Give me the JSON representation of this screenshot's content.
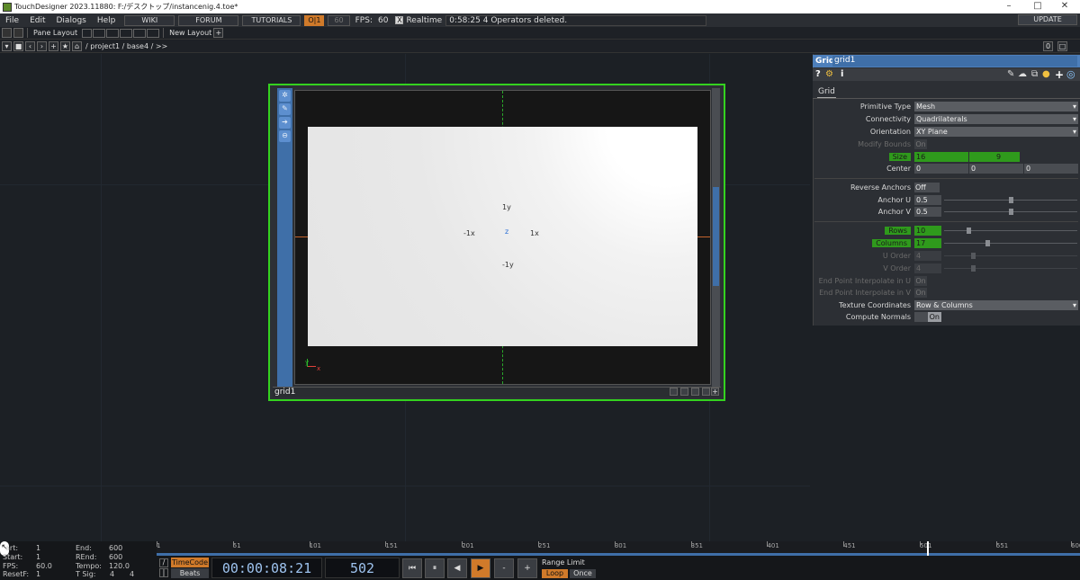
{
  "window": {
    "title": "TouchDesigner 2023.11880: F:/デスクトップ/instancenig.4.toe*",
    "minimize": "–",
    "maximize": "□",
    "close": "✕"
  },
  "menubar": {
    "items": [
      "File",
      "Edit",
      "Dialogs",
      "Help"
    ],
    "wiki": "WIKI",
    "forum": "FORUM",
    "tutorials": "TUTORIALS",
    "oi": "O|1",
    "fps_value_dim": "60",
    "fps_label": "FPS:",
    "fps_value": "60",
    "realtime_check": "X",
    "realtime_label": "Realtime",
    "message": "0:58:25 4 Operators deleted.",
    "update": "UPDATE"
  },
  "toolbar": {
    "pane_layout": "Pane Layout",
    "new_layout": "New Layout",
    "plus": "+"
  },
  "pathbar": {
    "path": "/ project1 / base4 / >>",
    "right_num": "0",
    "right_close": "□"
  },
  "operator": {
    "name": "grid1",
    "labels": {
      "y_pos": "1y",
      "y_neg": "-1y",
      "x_pos": "1x",
      "x_neg": "-1x",
      "z": "z"
    },
    "gizmo": {
      "y": "y",
      "x": "x"
    }
  },
  "params": {
    "op_type": "Grid",
    "op_name": "grid1",
    "tab": "Grid",
    "rows": [
      {
        "label": "Primitive Type",
        "value": "Mesh"
      },
      {
        "label": "Connectivity",
        "value": "Quadrilaterals"
      },
      {
        "label": "Orientation",
        "value": "XY Plane"
      },
      {
        "label": "Modify Bounds",
        "value": "On"
      },
      {
        "label": "Size",
        "v1": "16",
        "v2": "9"
      },
      {
        "label": "Center",
        "v1": "0",
        "v2": "0",
        "v3": "0"
      },
      {
        "label": "Reverse Anchors",
        "value": "Off"
      },
      {
        "label": "Anchor U",
        "value": "0.5"
      },
      {
        "label": "Anchor V",
        "value": "0.5"
      },
      {
        "label": "Rows",
        "value": "10"
      },
      {
        "label": "Columns",
        "value": "17"
      },
      {
        "label": "U Order",
        "value": "4"
      },
      {
        "label": "V Order",
        "value": "4"
      },
      {
        "label": "End Point Interpolate in U",
        "value": "On"
      },
      {
        "label": "End Point Interpolate in V",
        "value": "On"
      },
      {
        "label": "Texture Coordinates",
        "value": "Row & Columns"
      },
      {
        "label": "Compute Normals",
        "value": "On"
      }
    ]
  },
  "timeline": {
    "start_label": "art:",
    "start": "1",
    "rstart_label": "Start:",
    "rstart": "1",
    "fps_label": "FPS:",
    "fps": "60.0",
    "resetf_label": "ResetF:",
    "resetf": "1",
    "end_label": "End:",
    "end": "600",
    "rend_label": "REnd:",
    "rend": "600",
    "tempo_label": "Tempo:",
    "tempo": "120.0",
    "tsig_label": "T Sig:",
    "tsig1": "4",
    "tsig2": "4",
    "timecode_btn": "TimeCode",
    "beats_btn": "Beats",
    "timecode": "00:00:08:21",
    "frame": "502",
    "range_limit": "Range Limit",
    "loop": "Loop",
    "once": "Once",
    "ruler": [
      "1",
      "51",
      "101",
      "151",
      "201",
      "251",
      "301",
      "351",
      "401",
      "451",
      "501",
      "551",
      "600"
    ],
    "minus": "-",
    "plus": "+"
  }
}
